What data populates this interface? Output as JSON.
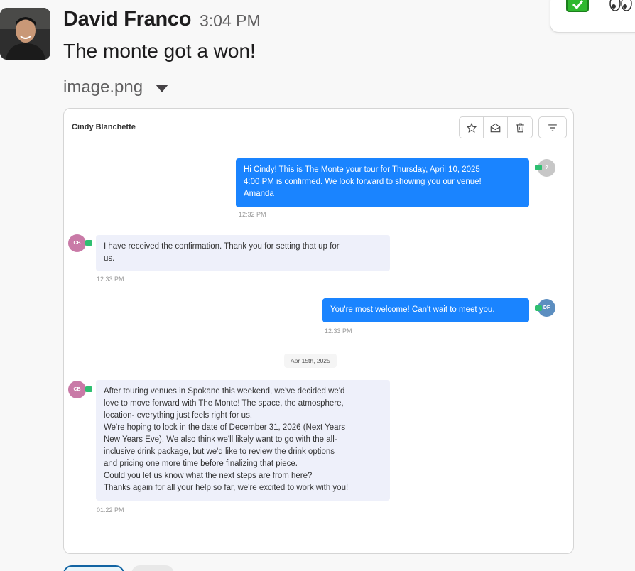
{
  "post": {
    "author": "David Franco",
    "time": "3:04 PM",
    "message": "The monte got a won!",
    "file_name": "image.png"
  },
  "reactions": [
    {
      "icon": "check-mark-icon"
    },
    {
      "icon": "eyes-icon"
    }
  ],
  "card": {
    "contact_name": "Cindy Blanchette",
    "toolbar_icons": [
      "star-icon",
      "envelope-open-icon",
      "trash-icon",
      "filter-icon"
    ],
    "messages": [
      {
        "direction": "outgoing",
        "avatar": "?",
        "text": "Hi Cindy! This is The Monte your tour for Thursday, April 10, 2025\n4:00 PM is confirmed. We look forward to showing you our venue!\nAmanda",
        "time": "12:32 PM"
      },
      {
        "direction": "incoming",
        "avatar": "CB",
        "text": "I have received the confirmation. Thank you for setting that up for\nus.",
        "time": "12:33 PM"
      },
      {
        "direction": "outgoing",
        "avatar": "DF",
        "text": "You're most welcome! Can't wait to meet you.",
        "time": "12:33 PM"
      },
      {
        "direction": "incoming",
        "avatar": "CB",
        "text": "After touring venues in Spokane this weekend, we've decided we'd\nlove to move forward with The Monte! The space, the atmosphere,\nlocation- everything just feels right for us.\nWe're hoping to lock in the date of December 31, 2026 (Next Years\nNew Years Eve). We also think we'll likely want to go with the all-\ninclusive drink package, but we'd like to review the drink options\nand pricing one more time before finalizing that piece.\nCould you let us know what the next steps are from here?\nThanks again for all your help so far, we're excited to work with you!",
        "time": "01:22 PM"
      }
    ],
    "date_divider": "Apr 15th, 2025"
  },
  "colors": {
    "outgoing_bubble": "#1a84ff",
    "incoming_bubble": "#eef0fa",
    "sms_badge": "#2fbf71"
  }
}
